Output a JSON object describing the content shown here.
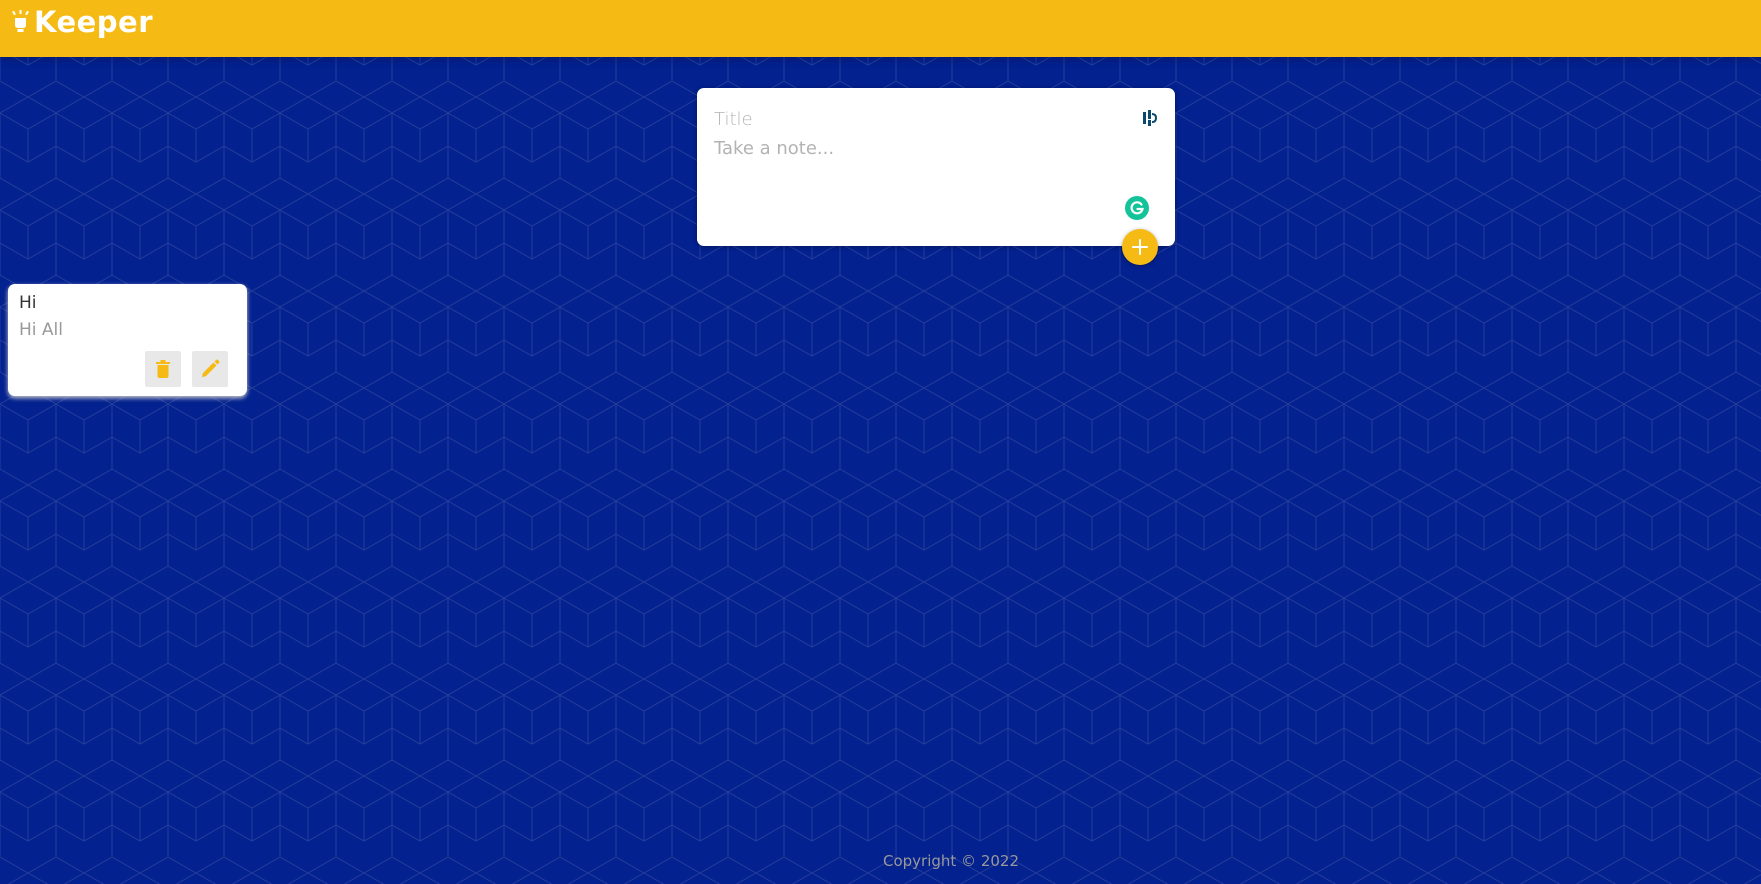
{
  "header": {
    "app_name": "Keeper",
    "background_color": "#f5ba13",
    "logo_icon": "lightbulb-icon"
  },
  "create_note": {
    "title_placeholder": "Title",
    "content_placeholder": "Take a note...",
    "extension_icon": "extension-icon",
    "grammarly_icon": "grammarly-icon",
    "add_button_icon": "plus-icon"
  },
  "notes": [
    {
      "title": "Hi",
      "content": "Hi All",
      "delete_icon": "trash-icon",
      "edit_icon": "pencil-icon"
    }
  ],
  "footer": {
    "copyright": "Copyright © 2022"
  },
  "colors": {
    "accent": "#f5ba13",
    "background": "#03218f",
    "card": "#ffffff",
    "grammarly": "#15c39a"
  }
}
